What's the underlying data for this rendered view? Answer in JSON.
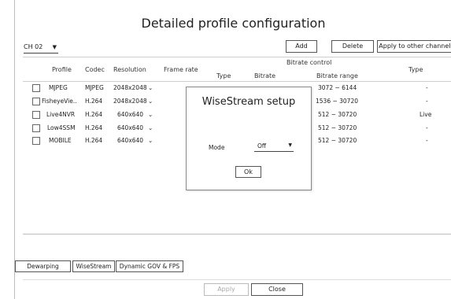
{
  "title": "Detailed profile configuration",
  "channel": {
    "value": "CH 02",
    "arrow": "▼"
  },
  "toolbar": {
    "add": "Add",
    "delete": "Delete",
    "apply_other": "Apply to other channels"
  },
  "table": {
    "headers": {
      "profile": "Profile",
      "codec": "Codec",
      "resolution": "Resolution",
      "frame_rate": "Frame rate",
      "bitrate_control": "Bitrate control",
      "type": "Type",
      "bitrate": "Bitrate",
      "bitrate_range": "Bitrate range",
      "type2": "Type"
    },
    "rows": [
      {
        "profile": "MJPEG",
        "codec": "MJPEG",
        "resolution": "2048x2048",
        "dd": "⌄",
        "range": "3072 ~ 6144",
        "type": "-"
      },
      {
        "profile": "FisheyeVie..",
        "codec": "H.264",
        "resolution": "2048x2048",
        "dd": "⌄",
        "range": "1536 ~ 30720",
        "type": "-"
      },
      {
        "profile": "Live4NVR",
        "codec": "H.264",
        "resolution": "640x640",
        "dd": "⌄",
        "range": "512 ~ 30720",
        "type": "Live"
      },
      {
        "profile": "Low4SSM",
        "codec": "H.264",
        "resolution": "640x640",
        "dd": "⌄",
        "range": "512 ~ 30720",
        "type": "-"
      },
      {
        "profile": "MOBILE",
        "codec": "H.264",
        "resolution": "640x640",
        "dd": "⌄",
        "range": "512 ~ 30720",
        "type": "-"
      }
    ]
  },
  "tabs": {
    "dewarping": "Dewarping",
    "wisestream": "WiseStream",
    "dynamic": "Dynamic GOV & FPS"
  },
  "footer": {
    "apply": "Apply",
    "close": "Close"
  },
  "modal": {
    "title": "WiseStream setup",
    "mode_label": "Mode",
    "mode_value": "Off",
    "arrow": "▼",
    "ok": "Ok"
  }
}
